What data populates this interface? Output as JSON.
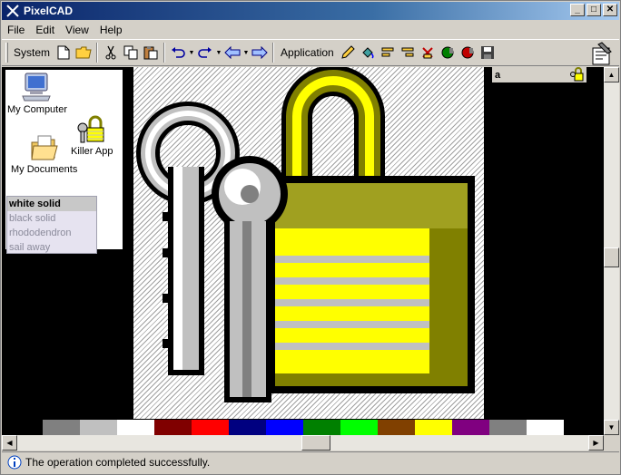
{
  "window": {
    "title": "PixelCAD"
  },
  "titlebar": {
    "minimize": "_",
    "maximize": "□",
    "close": "✕"
  },
  "menu": [
    "File",
    "Edit",
    "View",
    "Help"
  ],
  "toolbar": {
    "system_label": "System",
    "application_label": "Application"
  },
  "desktop": {
    "icons": [
      {
        "label": "My Computer",
        "icon": "computer-icon"
      },
      {
        "label": "Killer App",
        "icon": "lock-icon"
      },
      {
        "label": "My Documents",
        "icon": "documents-icon"
      }
    ]
  },
  "list": {
    "items": [
      "white solid",
      "black solid",
      "rhododendron",
      "sail away"
    ],
    "selected_index": 0
  },
  "side_panel": {
    "header": "a"
  },
  "palette": [
    "#808080",
    "#c0c0c0",
    "#ffffff",
    "#800000",
    "#ff0000",
    "#000080",
    "#0000ff",
    "#008000",
    "#00ff00",
    "#804000",
    "#ffff00",
    "#800080",
    "#808080",
    "#ffffff"
  ],
  "status": {
    "text": "The operation completed successfully."
  },
  "colors": {
    "title_start": "#0a246a",
    "title_end": "#a6caf0",
    "yellow": "#ffff00",
    "olive": "#808000"
  }
}
